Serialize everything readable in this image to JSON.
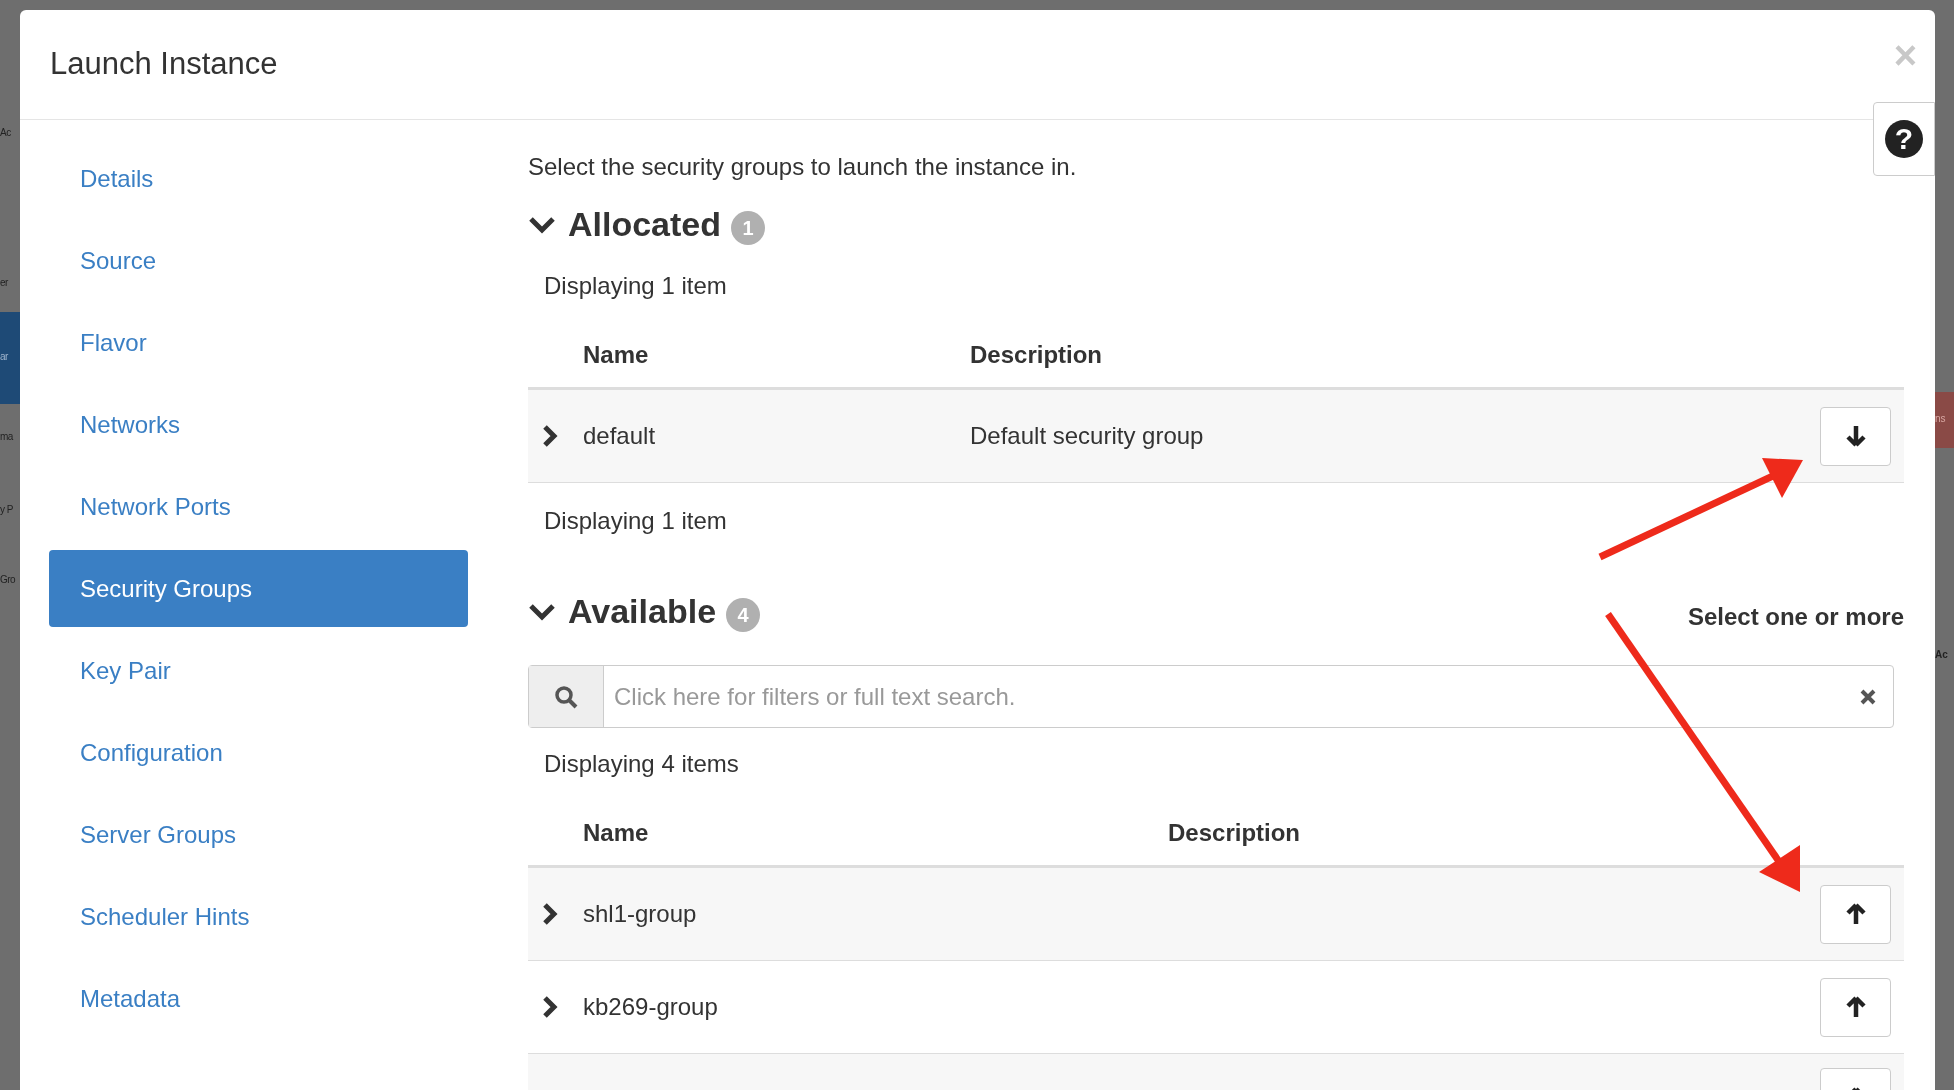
{
  "backdrop": {
    "left_fragments": [
      {
        "text": "Ac",
        "highlighted": false
      },
      {
        "text": "er",
        "highlighted": false
      },
      {
        "text": "ar",
        "highlighted": true
      },
      {
        "text": "ma",
        "highlighted": false
      },
      {
        "text": "y P",
        "highlighted": false
      },
      {
        "text": "Gro",
        "highlighted": false
      }
    ],
    "right_fragments": [
      {
        "text": "ns",
        "highlighted": true
      },
      {
        "text": "Ac",
        "highlighted": false
      }
    ]
  },
  "dialog": {
    "title": "Launch Instance",
    "close": "×",
    "help": "?"
  },
  "sidebar": {
    "items": [
      {
        "label": "Details",
        "selected": false
      },
      {
        "label": "Source",
        "selected": false
      },
      {
        "label": "Flavor",
        "selected": false
      },
      {
        "label": "Networks",
        "selected": false
      },
      {
        "label": "Network Ports",
        "selected": false
      },
      {
        "label": "Security Groups",
        "selected": true
      },
      {
        "label": "Key Pair",
        "selected": false
      },
      {
        "label": "Configuration",
        "selected": false
      },
      {
        "label": "Server Groups",
        "selected": false
      },
      {
        "label": "Scheduler Hints",
        "selected": false
      },
      {
        "label": "Metadata",
        "selected": false
      }
    ]
  },
  "intro": "Select the security groups to launch the instance in.",
  "allocated": {
    "title": "Allocated",
    "count": "1",
    "expanded": true,
    "display_top": "Displaying 1 item",
    "columns": [
      "Name",
      "Description"
    ],
    "rows": [
      {
        "name": "default",
        "description": "Default security group"
      }
    ],
    "display_bottom": "Displaying 1 item"
  },
  "available": {
    "title": "Available",
    "count": "4",
    "expanded": true,
    "hint": "Select one or more",
    "search": {
      "placeholder": "Click here for filters or full text search."
    },
    "display_top": "Displaying 4 items",
    "columns": [
      "Name",
      "Description"
    ],
    "rows": [
      {
        "name": "shl1-group",
        "description": ""
      },
      {
        "name": "kb269-group",
        "description": ""
      },
      {
        "name": "",
        "description": ""
      }
    ]
  }
}
